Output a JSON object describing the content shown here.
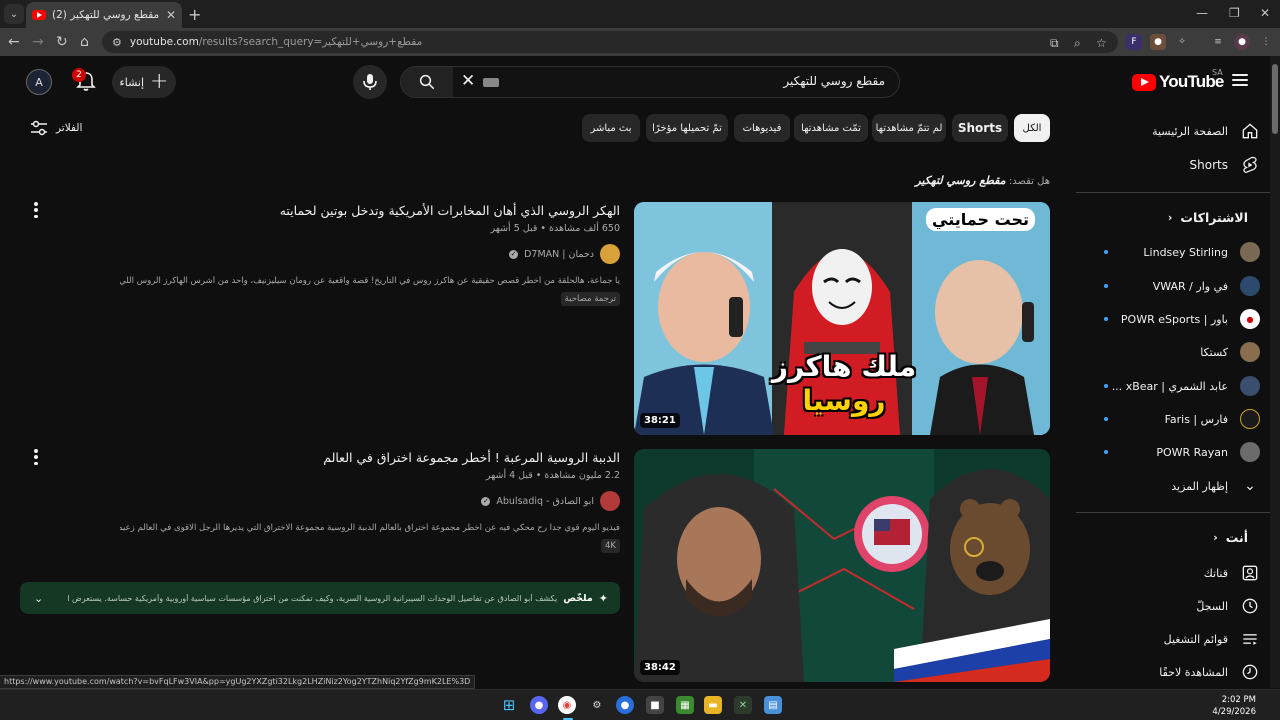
{
  "browser": {
    "tab_title": "(2) مقطع روسي للتهكير - YouTube",
    "url_host": "youtube.com",
    "url_path": "/results?search_query=مقطع+روسي+للتهكير",
    "hover_url": "https://www.youtube.com/watch?v=bvFqLFw3VIA&pp=ygUg2YXZgti32Lkg2LHZiNiz2Yog2YTZhNiq2YfZg9mK2LE%3D"
  },
  "header": {
    "logo_text": "YouTube",
    "country_code": "SA",
    "search_query": "مقطع روسي للتهكير",
    "create_label": "إنشاء",
    "notification_count": "2",
    "account_initial": "A"
  },
  "sidebar": {
    "nav": [
      {
        "label": "الصفحة الرئيسية",
        "icon": "home-icon"
      },
      {
        "label": "Shorts",
        "icon": "shorts-icon"
      }
    ],
    "subscriptions_heading": "الاشتراكات",
    "subscriptions": [
      {
        "label": "Lindsey Stirling",
        "color": "#7a6a55",
        "live": true
      },
      {
        "label": "في وار / VWAR",
        "color": "#2c4a6b",
        "live": true
      },
      {
        "label": "باور | POWR eSports",
        "color": "#ffffff",
        "live": true
      },
      {
        "label": "كستكا",
        "color": "#8a6d4f",
        "live": false
      },
      {
        "label": "عابد الشمري | xBear ...",
        "color": "#3a4e6e",
        "live": true
      },
      {
        "label": "فارس | Faris",
        "color": "#1a1a1a",
        "live": true
      },
      {
        "label": "POWR Rayan",
        "color": "#6b6b6b",
        "live": true
      }
    ],
    "show_more_label": "إظهار المزيد",
    "you_heading": "أنت",
    "you_items": [
      {
        "label": "قناتك",
        "icon": "your-channel-icon"
      },
      {
        "label": "السجلّ",
        "icon": "history-icon"
      },
      {
        "label": "قوائم التشغيل",
        "icon": "playlists-icon"
      },
      {
        "label": "المشاهدة لاحقًا",
        "icon": "watch-later-icon"
      }
    ]
  },
  "chips": [
    "الكل",
    "Shorts",
    "لم تتمّ مشاهدتها",
    "تمّت مشاهدتها",
    "فيديوهات",
    "تمّ تحميلها مؤخرًا",
    "بث مباشر"
  ],
  "filters_label": "الفلاتر",
  "did_you_mean": {
    "prefix": "هل تقصد:",
    "query": "مقطع روسي لتهكير"
  },
  "results": [
    {
      "title": "الهكر الروسي الذي أهان المخابرات الأمريكية وتدخل بوتين لحمايته",
      "stats": "650 ألف مشاهدة • قبل 5 أشهر",
      "channel": "دحمان | D7MAN",
      "description": "يا جماعة، هالحلقة من أخطر قصص حقيقية عن هاكرز روس في التاريخ! قصة واقعية عن رومان سيليزنيف، واحد من أشرس الهاكرز الروس اللي اخترق ...",
      "badge": "ترجمة مصاحبة",
      "duration": "38:21",
      "thumb_text_top": "تحت حمايتي",
      "thumb_text_bottom_1": "ملك هاكرز",
      "thumb_text_bottom_2": "روسيا"
    },
    {
      "title": "الدببة الروسية المرعبة ! أخطر مجموعة اختراق في العالم",
      "stats": "2.2 مليون مشاهدة • قبل 4 أشهر",
      "channel": "ابو الصادق - Abulsadiq",
      "description": "فيديو اليوم قوي جدا رح محكي فيه عن اخطر مجموعة اختراق بالعالم الدببة الروسية مجموعة الاختراق التي يديرها الرجل الاقوى في العالم زعيم ...",
      "badge": "4K",
      "duration": "38:42"
    }
  ],
  "summary": {
    "heading": "ملخّص",
    "text": "يكشف أبو الصادق عن تفاصيل الوحدات السيبرانية الروسية السرية، وكيف تمكنت من اختراق مؤسسات سياسية أوروبية وأمريكية حساسة. يستعرض الفيديو..."
  },
  "taskbar": {
    "time": "2:02 PM",
    "date": "4/29/2026"
  },
  "colors": {
    "background": "#0f0f0f",
    "accent_red": "#ff0000",
    "chip": "#272727",
    "summary_bg": "#143824"
  }
}
